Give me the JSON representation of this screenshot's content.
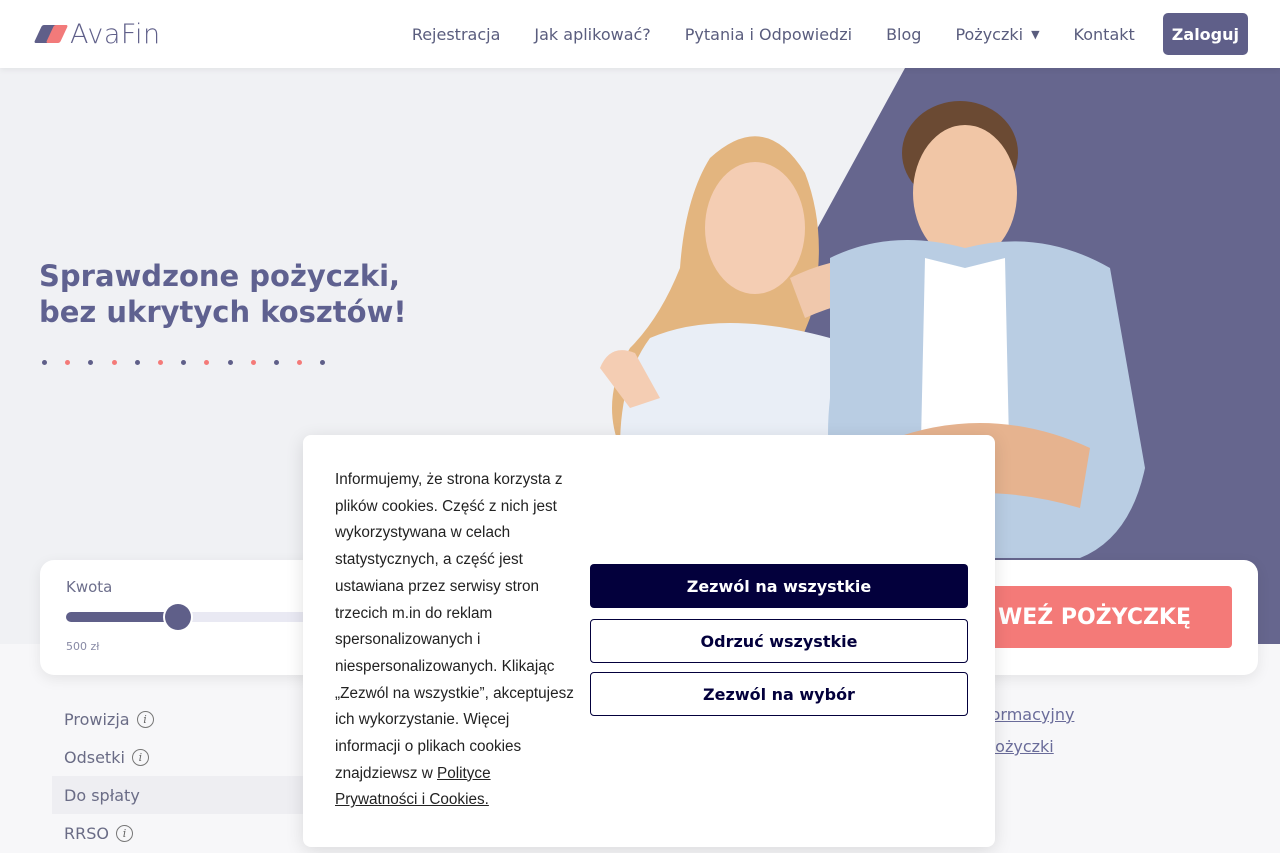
{
  "brand": {
    "name": "AvaFin",
    "colors": {
      "primary": "#5f5f89",
      "accent": "#f47a78",
      "dark": "#03003c"
    }
  },
  "nav": {
    "items": [
      "Rejestracja",
      "Jak aplikować?",
      "Pytania i Odpowiedzi",
      "Blog",
      "Pożyczki",
      "Kontakt"
    ],
    "dropdown_icon": "caret-down-icon",
    "login_label": "Zaloguj"
  },
  "hero": {
    "title_line1": "Sprawdzone pożyczki,",
    "title_line2": "bez ukrytych kosztów!",
    "dot_colors": [
      "#5f5f89",
      "#f47a78",
      "#5f5f89",
      "#f47a78",
      "#5f5f89",
      "#f47a78",
      "#5f5f89",
      "#f47a78",
      "#5f5f89",
      "#f47a78",
      "#5f5f89",
      "#f47a78",
      "#5f5f89"
    ]
  },
  "calculator": {
    "amount_label": "Kwota",
    "amount_min": "500 zł",
    "slider_fraction": 0.4,
    "cta_label": "WEŹ POŻYCZKĘ"
  },
  "info": {
    "rows": [
      {
        "label": "Prowizja",
        "icon": "info-icon"
      },
      {
        "label": "Odsetki",
        "icon": "info-icon"
      },
      {
        "label": "Do spłaty",
        "icon": ""
      },
      {
        "label": "RRSO",
        "icon": "info-icon"
      }
    ],
    "links": [
      "formacyjny",
      "pożyczki"
    ]
  },
  "cookie": {
    "text": "Informujemy, że strona korzysta z plików cookies. Część z nich jest wykorzystywana w celach statystycznych, a część jest ustawiana przez serwisy stron trzecich m.in do reklam spersonalizowanych i niespersonalizowanych. Klikając „Zezwól na wszystkie”, akceptujesz ich wykorzystanie. Więcej informacji o plikach cookies znajdziewsz w ",
    "link_text": "Polityce Prywatności i Cookies.",
    "allow_all": "Zezwól na wszystkie",
    "reject_all": "Odrzuć wszystkie",
    "allow_choice": "Zezwól na wybór"
  }
}
